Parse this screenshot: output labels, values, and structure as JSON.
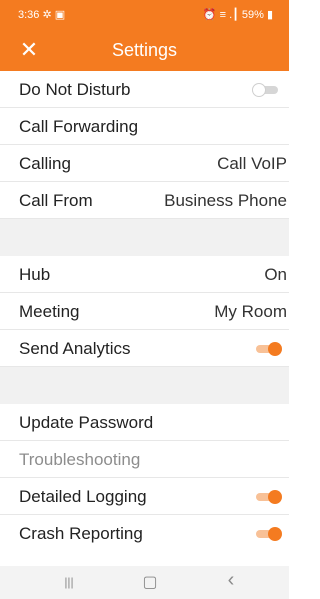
{
  "status_bar": {
    "time": "3:36",
    "left_icons": "✲ ▣",
    "right_text": "⏰ ≡ .┃ 59% ▮"
  },
  "header": {
    "close_glyph": "✕",
    "title": "Settings"
  },
  "settings": {
    "do_not_disturb": {
      "label": "Do Not Disturb",
      "enabled": false
    },
    "call_forwarding": {
      "label": "Call Forwarding"
    },
    "calling": {
      "label": "Calling",
      "value": "Call VoIP"
    },
    "call_from": {
      "label": "Call From",
      "value": "Business Phone"
    },
    "hub": {
      "label": "Hub",
      "value": "On"
    },
    "meeting": {
      "label": "Meeting",
      "value": "My Room"
    },
    "send_analytics": {
      "label": "Send Analytics",
      "enabled": true
    },
    "update_password": {
      "label": "Update Password"
    },
    "troubleshooting": {
      "label": "Troubleshooting"
    },
    "detailed_logging": {
      "label": "Detailed Logging",
      "enabled": true
    },
    "crash_reporting": {
      "label": "Crash Reporting",
      "enabled": true
    }
  },
  "navbar": {
    "recents": "|||",
    "home": "▢",
    "back": "‹"
  },
  "colors": {
    "accent": "#f47b20",
    "spacer": "#f1f1f1",
    "heading_text": "#8d8d8d"
  }
}
